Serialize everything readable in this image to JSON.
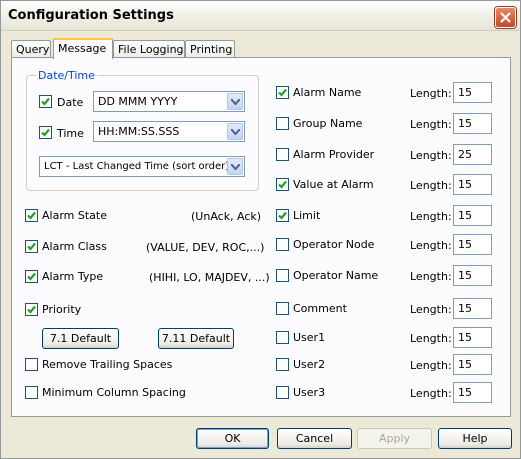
{
  "window": {
    "title": "Configuration Settings"
  },
  "tabs": [
    "Query",
    "Message",
    "File Logging",
    "Printing"
  ],
  "datetime": {
    "group_label": "Date/Time",
    "date": {
      "label": "Date",
      "checked": true,
      "value": "DD MMM YYYY"
    },
    "time": {
      "label": "Time",
      "checked": true,
      "value": "HH:MM:SS.SSS"
    },
    "sort": {
      "value": "LCT - Last Changed Time (sort order)"
    }
  },
  "left_options": [
    {
      "label": "Alarm State",
      "checked": true,
      "hint": "(UnAck, Ack)"
    },
    {
      "label": "Alarm Class",
      "checked": true,
      "hint": "(VALUE, DEV, ROC,...)"
    },
    {
      "label": "Alarm Type",
      "checked": true,
      "hint": "(HIHI, LO, MAJDEV, ...)"
    },
    {
      "label": "Priority",
      "checked": true,
      "hint": ""
    }
  ],
  "default_buttons": [
    "7.1 Default",
    "7.11 Default"
  ],
  "bottom_options": [
    {
      "label": "Remove Trailing Spaces",
      "checked": false
    },
    {
      "label": "Minimum Column Spacing",
      "checked": false
    }
  ],
  "length_label": "Length:",
  "fields": [
    {
      "label": "Alarm Name",
      "checked": true,
      "length": "15"
    },
    {
      "label": "Group Name",
      "checked": false,
      "length": "15"
    },
    {
      "label": "Alarm Provider",
      "checked": false,
      "length": "25"
    },
    {
      "label": "Value at Alarm",
      "checked": true,
      "length": "15"
    },
    {
      "label": "Limit",
      "checked": true,
      "length": "15"
    },
    {
      "label": "Operator Node",
      "checked": false,
      "length": "15"
    },
    {
      "label": "Operator Name",
      "checked": false,
      "length": "15"
    },
    {
      "label": "Comment",
      "checked": false,
      "length": "15"
    },
    {
      "label": "User1",
      "checked": false,
      "length": "15"
    },
    {
      "label": "User2",
      "checked": false,
      "length": "15"
    },
    {
      "label": "User3",
      "checked": false,
      "length": "15"
    }
  ],
  "footer": {
    "ok": "OK",
    "cancel": "Cancel",
    "apply": "Apply",
    "help": "Help"
  },
  "colors": {
    "check": "#21a121",
    "accent": "#ffc83c",
    "group_label": "#0046d5"
  }
}
